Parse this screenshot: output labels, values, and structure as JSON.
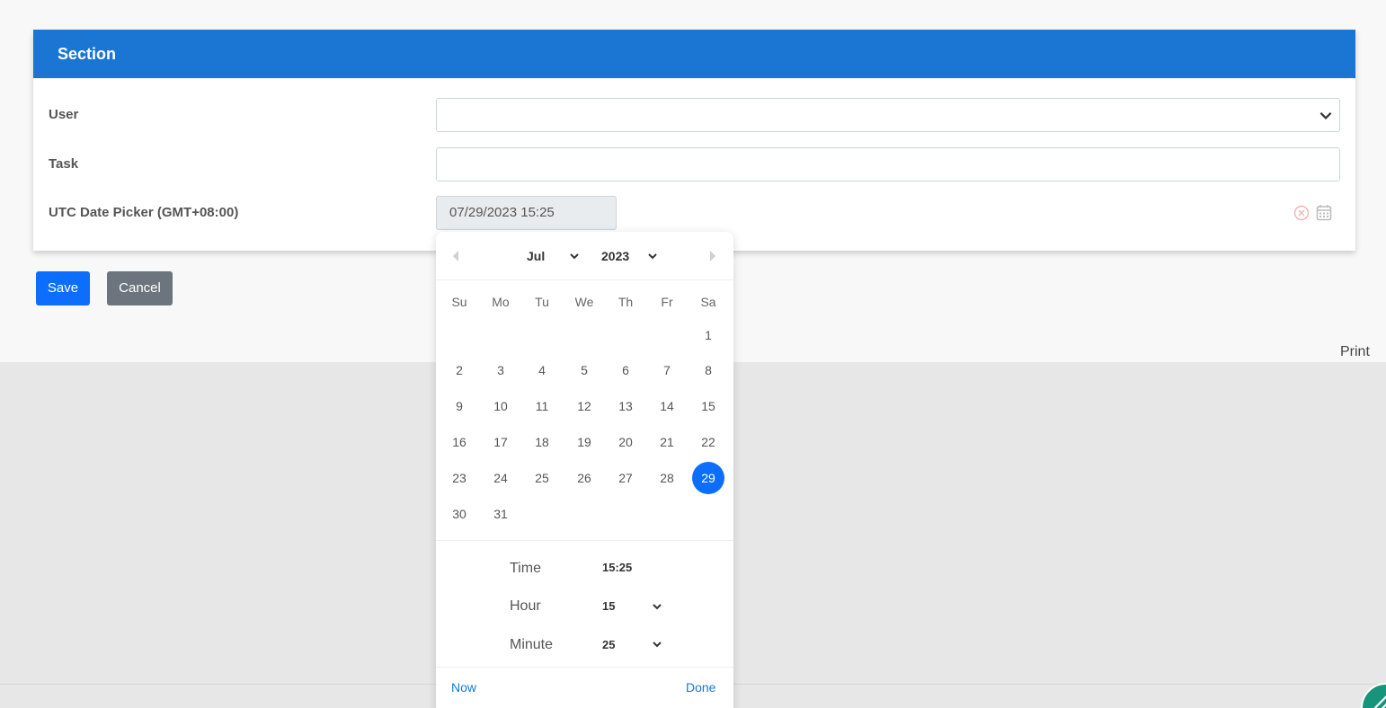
{
  "section": {
    "title": "Section"
  },
  "form": {
    "user_label": "User",
    "task_label": "Task",
    "date_label": "UTC Date Picker (GMT+08:00)",
    "user_value": "",
    "task_value": "",
    "date_value": "07/29/2023 15:25"
  },
  "buttons": {
    "save": "Save",
    "cancel": "Cancel"
  },
  "print_label": "Print",
  "picker": {
    "month": "Jul",
    "year": "2023",
    "weekdays": [
      "Su",
      "Mo",
      "Tu",
      "We",
      "Th",
      "Fr",
      "Sa"
    ],
    "days": [
      [
        "",
        "",
        "",
        "",
        "",
        "",
        "1"
      ],
      [
        "2",
        "3",
        "4",
        "5",
        "6",
        "7",
        "8"
      ],
      [
        "9",
        "10",
        "11",
        "12",
        "13",
        "14",
        "15"
      ],
      [
        "16",
        "17",
        "18",
        "19",
        "20",
        "21",
        "22"
      ],
      [
        "23",
        "24",
        "25",
        "26",
        "27",
        "28",
        "29"
      ],
      [
        "30",
        "31",
        "",
        "",
        "",
        "",
        ""
      ]
    ],
    "selected_day": "29",
    "time_label": "Time",
    "time_value": "15:25",
    "hour_label": "Hour",
    "hour_value": "15",
    "minute_label": "Minute",
    "minute_value": "25",
    "now_label": "Now",
    "done_label": "Done"
  },
  "colors": {
    "header": "#1b76d3",
    "primary": "#0d6efd",
    "secondary": "#6c757d",
    "fab": "#16947c"
  }
}
